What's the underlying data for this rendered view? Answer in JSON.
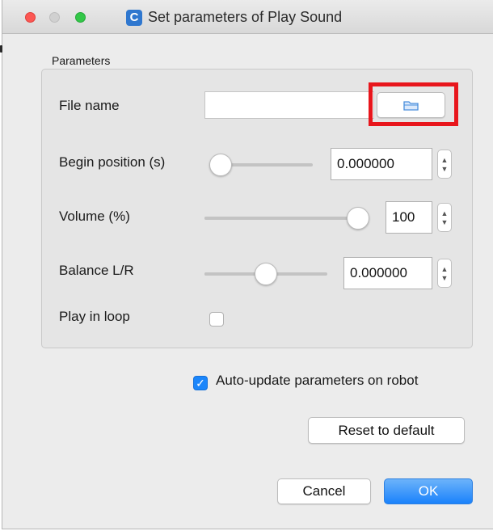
{
  "window": {
    "title": "Set parameters of Play Sound",
    "app_icon_letter": "C"
  },
  "group": {
    "label": "Parameters"
  },
  "fields": {
    "file_name": {
      "label": "File name",
      "value": "",
      "browse_icon": "folder-icon"
    },
    "begin_position": {
      "label": "Begin position (s)",
      "value": "0.000000",
      "slider_level": 0.0
    },
    "volume": {
      "label": "Volume (%)",
      "value": "100",
      "slider_level": 1.0
    },
    "balance": {
      "label": "Balance L/R",
      "value": "0.000000",
      "slider_level": 0.5
    },
    "play_in_loop": {
      "label": "Play in loop",
      "checked": false
    }
  },
  "auto_update": {
    "label": "Auto-update parameters on robot",
    "checked": true
  },
  "buttons": {
    "reset": "Reset to default",
    "cancel": "Cancel",
    "ok": "OK"
  },
  "colors": {
    "accent": "#1a82fb",
    "highlight": "#e8161c",
    "close": "#fc5753",
    "zoom": "#33c748",
    "app_icon": "#2f77cf"
  }
}
